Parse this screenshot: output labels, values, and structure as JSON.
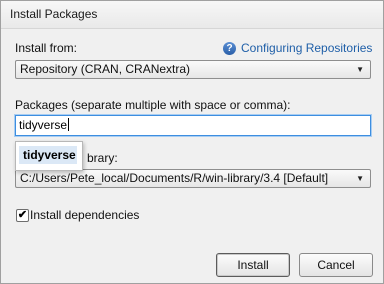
{
  "window": {
    "title": "Install Packages"
  },
  "install_from": {
    "label": "Install from:",
    "help_link": "Configuring Repositories",
    "selected": "Repository (CRAN, CRANextra)"
  },
  "packages": {
    "label": "Packages (separate multiple with space or comma):",
    "value": "tidyverse",
    "suggestion": "tidyverse"
  },
  "library": {
    "label_visible": "brary:",
    "selected": "C:/Users/Pete_local/Documents/R/win-library/3.4 [Default]"
  },
  "dependencies": {
    "label": "Install dependencies",
    "checked": true
  },
  "buttons": {
    "install": "Install",
    "cancel": "Cancel"
  },
  "icons": {
    "help": "?",
    "dropdown": "▼",
    "check": "✔"
  }
}
